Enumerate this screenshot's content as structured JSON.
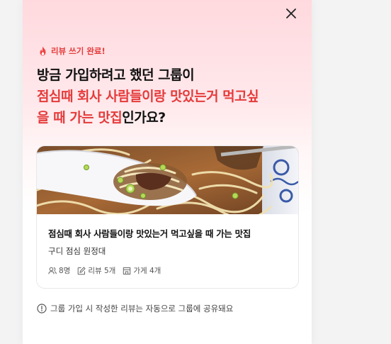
{
  "modal": {
    "close_icon": "close-icon",
    "badge": {
      "icon": "fire-icon",
      "text": "리뷰 쓰기 완료!",
      "color": "#e53b3b"
    },
    "headline": {
      "line1": "방금 가입하려고 했던 그룹이",
      "highlight_line2": "점심때 회사 사람들이랑 맛있는거 먹고싶",
      "highlight_line3": "을 때 가는 맛집",
      "suffix": "인가요?"
    },
    "group_card": {
      "image": "noodle-soup-photo",
      "title": "점심때 회사 사람들이랑 맛있는거 먹고싶을 때 가는 맛집",
      "subtitle": "구디 점심 원정대",
      "stats": [
        {
          "icon": "members-icon",
          "text": "8명"
        },
        {
          "icon": "edit-icon",
          "text": "리뷰 5개"
        },
        {
          "icon": "store-icon",
          "text": "가게 4개"
        }
      ]
    },
    "notice": {
      "icon": "info-icon",
      "text": "그룹 가입 시 작성한 리뷰는 자동으로 그룹에 공유돼요"
    }
  },
  "colors": {
    "accent": "#e53b3b",
    "background": "#f3f3f4"
  }
}
